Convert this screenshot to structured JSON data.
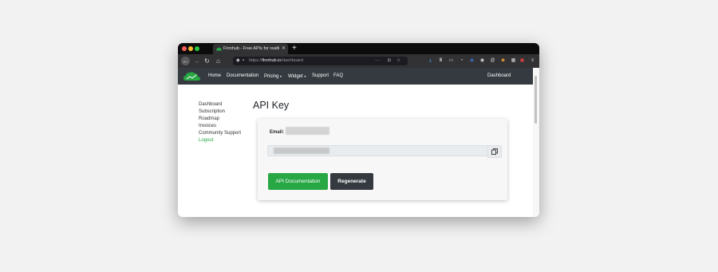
{
  "browser": {
    "tab_title": "Finnhub - Free APIs for realtim",
    "new_tab": "+",
    "url_protocol": "https://",
    "url_host": "finnhub.io",
    "url_path": "/dashboard",
    "url_display": "https://finnhub.io/dashboard"
  },
  "site_nav": {
    "links": {
      "home": "Home",
      "documentation": "Documentation",
      "pricing": "Pricing",
      "widget": "Widget",
      "support": "Support",
      "faq": "FAQ",
      "dashboard": "Dashboard"
    },
    "dropdown_caret": "▾"
  },
  "sidebar": {
    "items": [
      "Dashboard",
      "Subscription",
      "Roadmap",
      "Invoices",
      "Community Support",
      "Logout"
    ]
  },
  "main": {
    "title": "API Key",
    "email_label": "Email:",
    "buttons": {
      "api_docs": "API Documentation",
      "regenerate": "Regenerate"
    }
  },
  "colors": {
    "accent_green": "#28a745",
    "navbar_dark": "#343a40",
    "browser_chrome": "#323234"
  },
  "icons": {
    "back": "back-arrow-icon",
    "forward": "forward-arrow-icon",
    "reload": "reload-icon",
    "home": "home-icon",
    "copy": "copy-icon"
  }
}
